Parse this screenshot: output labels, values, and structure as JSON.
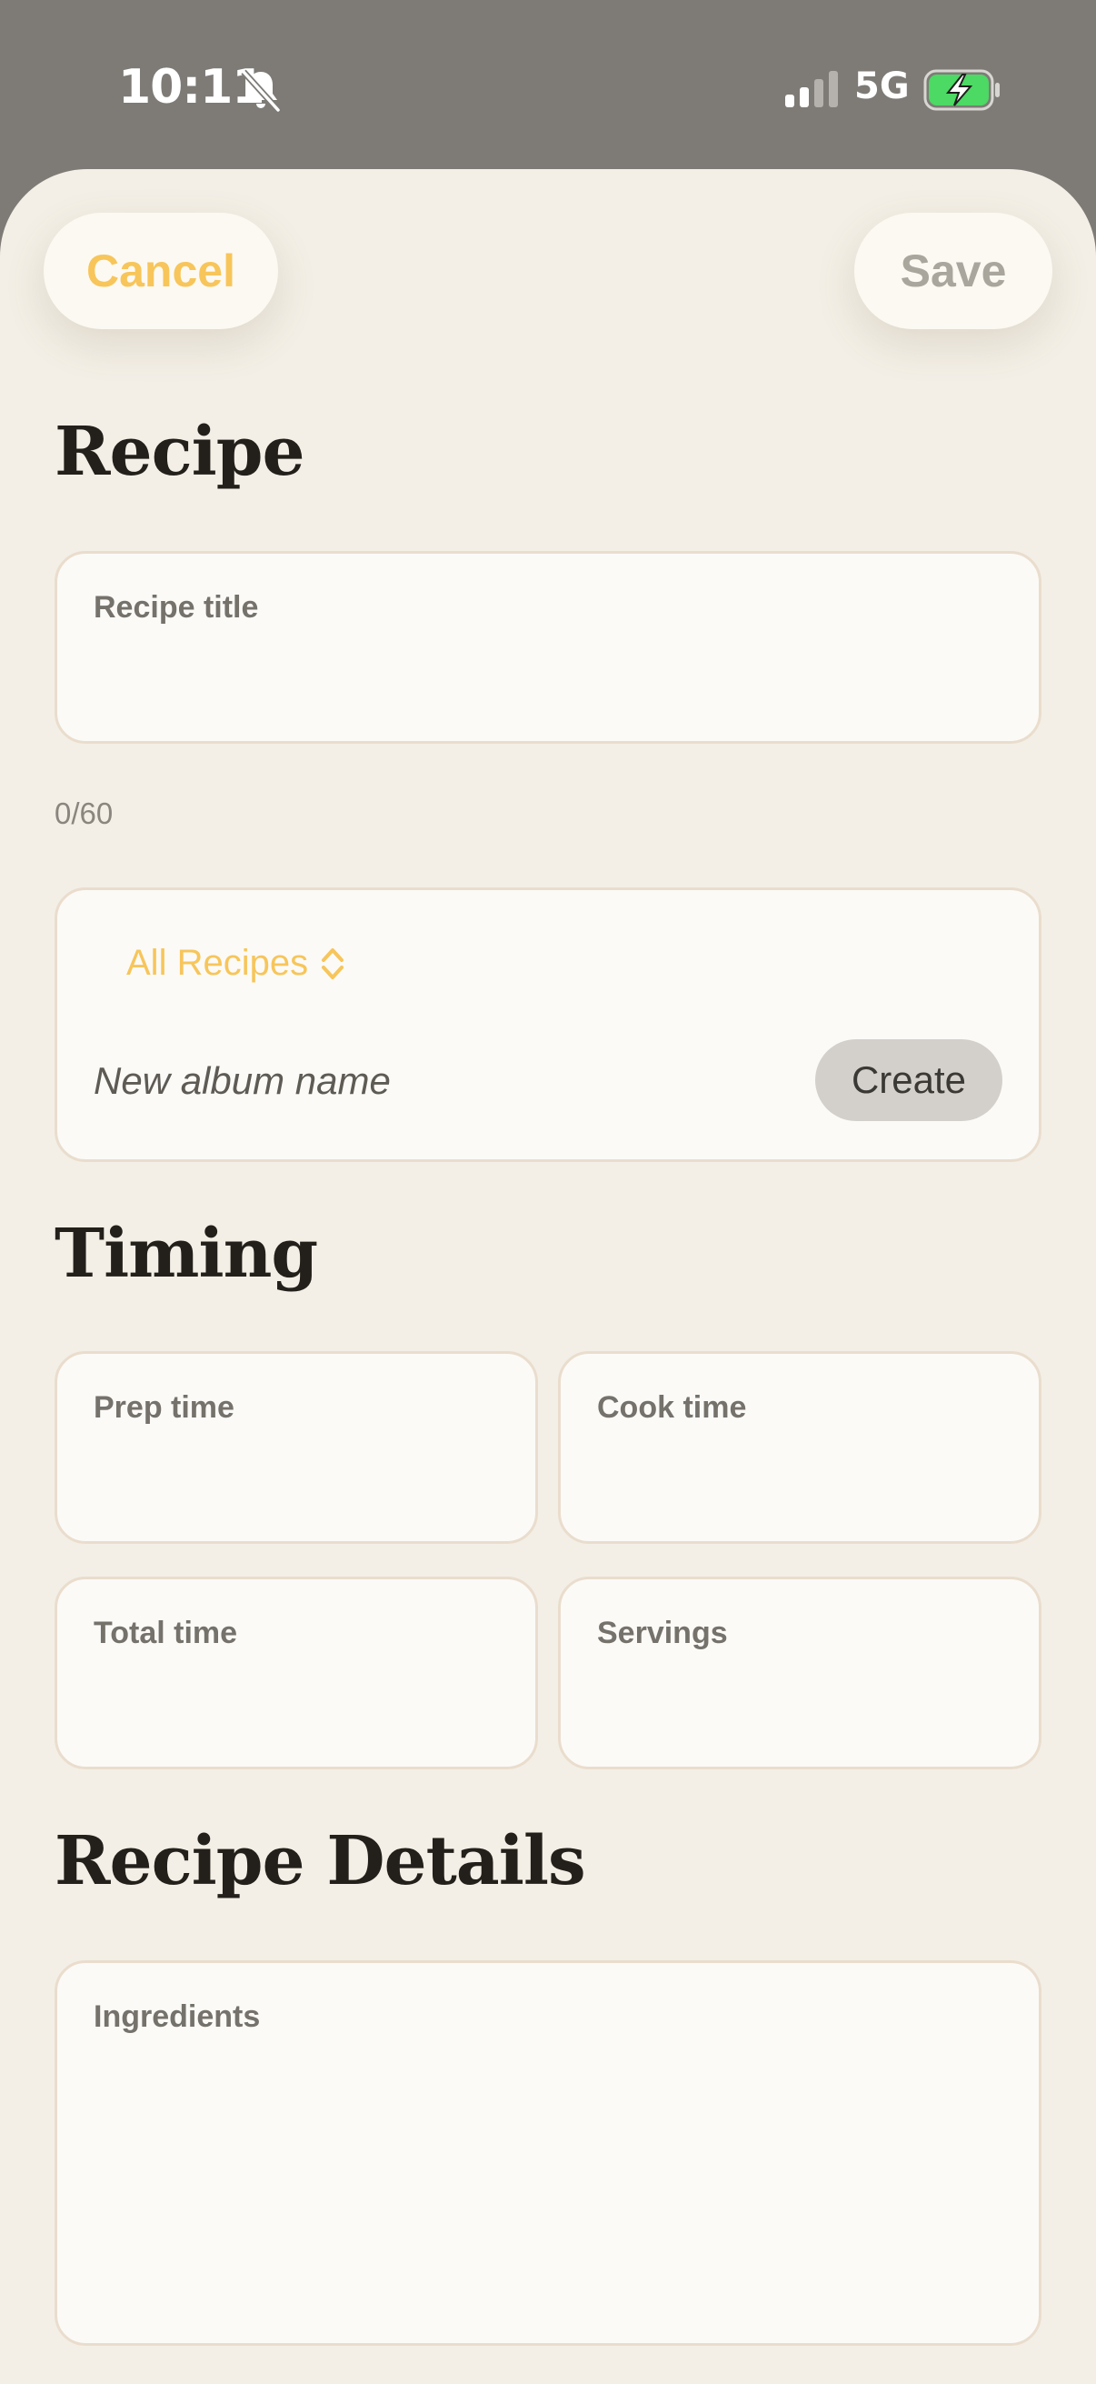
{
  "status_bar": {
    "time": "10:11",
    "network": "5G",
    "silent_icon": "bell-slash-icon",
    "signal_icon": "cellular-signal-icon",
    "battery_icon": "battery-charging-icon"
  },
  "nav": {
    "cancel_label": "Cancel",
    "save_label": "Save"
  },
  "sections": {
    "recipe_heading": "Recipe",
    "timing_heading": "Timing",
    "details_heading": "Recipe Details"
  },
  "recipe": {
    "title_label": "Recipe title",
    "title_value": "",
    "title_counter": "0/60",
    "album_selected": "All Recipes",
    "album_placeholder": "New album name",
    "create_label": "Create"
  },
  "timing": {
    "prep_label": "Prep time",
    "cook_label": "Cook time",
    "total_label": "Total time",
    "servings_label": "Servings"
  },
  "details": {
    "ingredients_label": "Ingredients"
  },
  "colors": {
    "accent": "#f7c55a",
    "background": "#f3efe6",
    "field": "#fbfaf7",
    "field_border": "#eaddcd",
    "battery_fill": "#4cd964"
  }
}
